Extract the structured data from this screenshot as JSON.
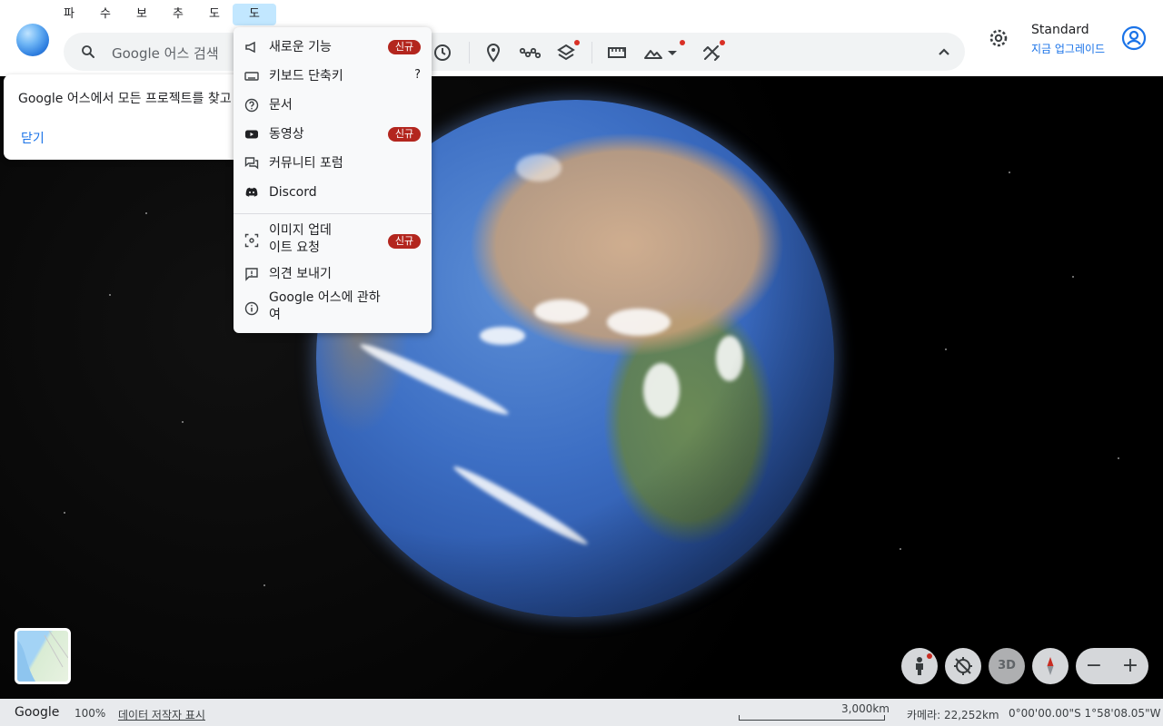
{
  "menubar": [
    "파",
    "수",
    "보",
    "추",
    "도",
    "도"
  ],
  "search": {
    "placeholder": "Google 어스 검색"
  },
  "account": {
    "plan": "Standard",
    "upgrade": "지금 업그레이드"
  },
  "hint": {
    "text": "Google 어스에서 모든 프로젝트를 찾고 관",
    "close": "닫기"
  },
  "help_menu": {
    "items": [
      {
        "label": "새로운 기능",
        "icon": "megaphone-icon",
        "badge": "신규"
      },
      {
        "label": "키보드 단축키",
        "icon": "keyboard-icon",
        "shortcut": "?"
      },
      {
        "label": "문서",
        "icon": "help-circle-icon"
      },
      {
        "label": "동영상",
        "icon": "youtube-icon",
        "badge": "신규"
      },
      {
        "label": "커뮤니티 포럼",
        "icon": "forum-icon"
      },
      {
        "label": "Discord",
        "icon": "discord-icon"
      },
      {
        "label": "이미지 업데\n이트 요청",
        "icon": "image-request-icon",
        "badge": "신규"
      },
      {
        "label": "의견 보내기",
        "icon": "feedback-icon"
      },
      {
        "label": "Google 어스에 관하\n여",
        "icon": "info-icon"
      }
    ]
  },
  "controls": {
    "three_d": "3D",
    "zoom_out": "−",
    "zoom_in": "+"
  },
  "status": {
    "brand": "Google",
    "zoom": "100%",
    "data": "데이터 저작자 표시",
    "scale": "3,000km",
    "camera": "카메라: 22,252km",
    "coords": "0°00'00.00\"S 1°58'08.05\"W"
  },
  "colors": {
    "accent": "#1a73e8",
    "badge": "#b3261e",
    "active_menu": "#c2e7ff"
  }
}
